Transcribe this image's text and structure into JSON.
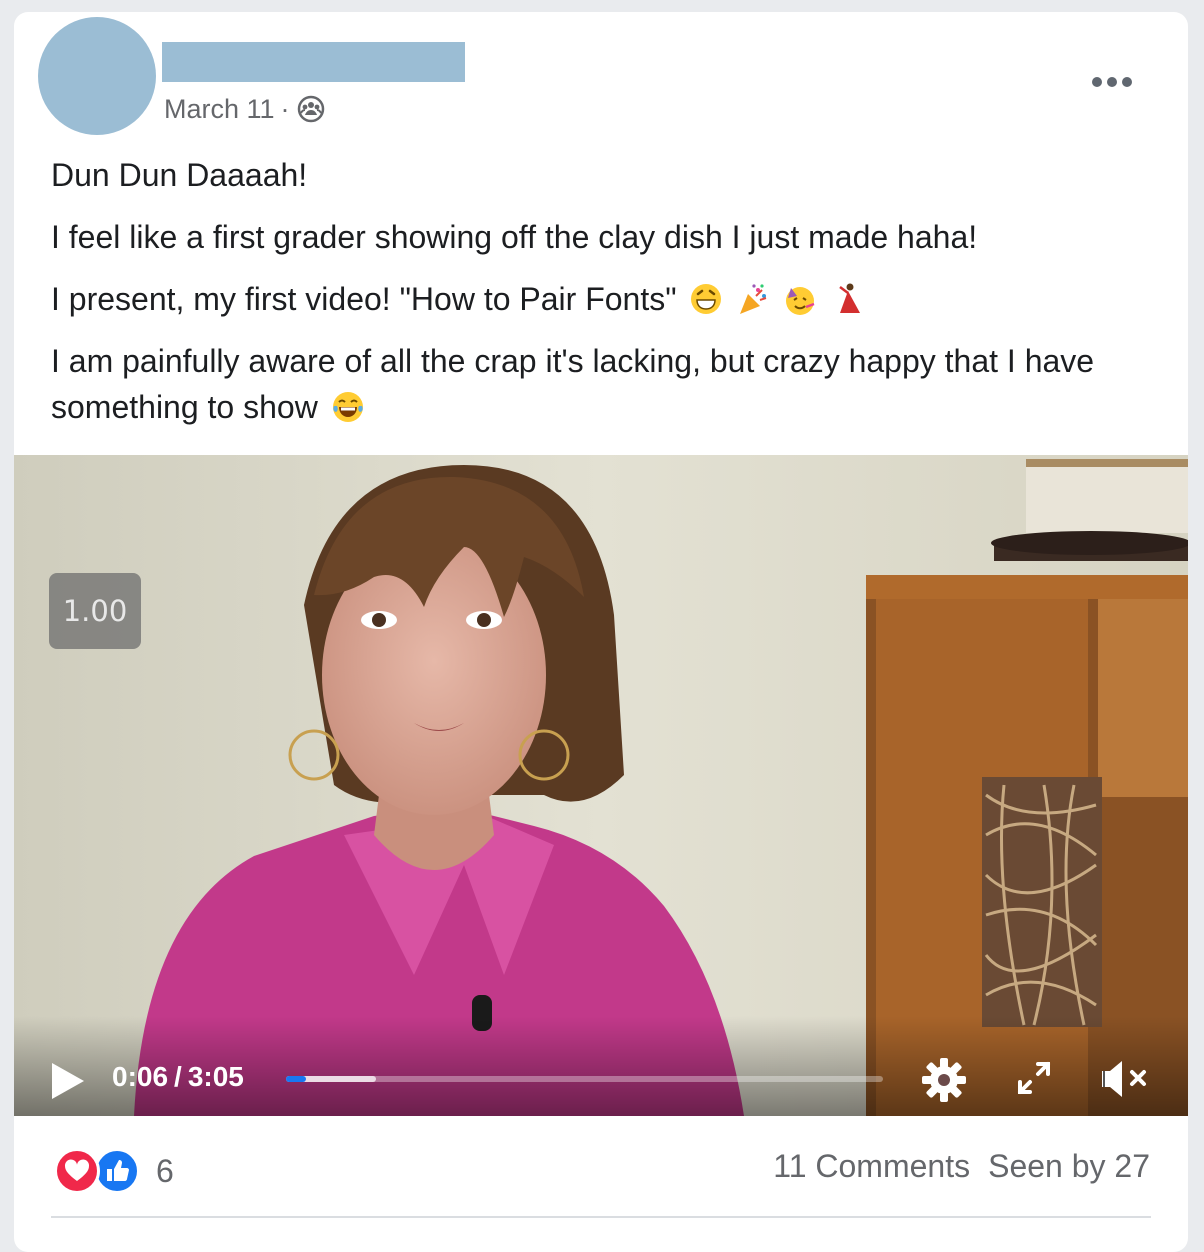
{
  "post": {
    "date": "March 11",
    "separator": "·",
    "audience_icon": "group-icon",
    "paragraphs": {
      "p1": "Dun Dun Daaaah!",
      "p2": "I feel like a first grader showing off the clay dish I just made haha!",
      "p3": "I present, my first video! \"How to Pair Fonts\"",
      "p4": "I am painfully aware of all the crap it's lacking, but crazy happy that I have something to show"
    },
    "emojis": [
      "grinning-face-icon",
      "party-popper-icon",
      "partying-face-icon",
      "dancer-icon",
      "tears-of-joy-icon"
    ]
  },
  "video": {
    "speed": "1.00",
    "current_time": "0:06",
    "time_separator": "/",
    "duration": "3:05",
    "played_fraction": 0.033,
    "buffered_fraction": 0.15,
    "accent_color": "#1877f2"
  },
  "footer": {
    "reaction_count": "6",
    "comments": "11 Comments",
    "seen_by": "Seen by 27",
    "reactions": [
      "love-reaction-icon",
      "like-reaction-icon"
    ]
  }
}
